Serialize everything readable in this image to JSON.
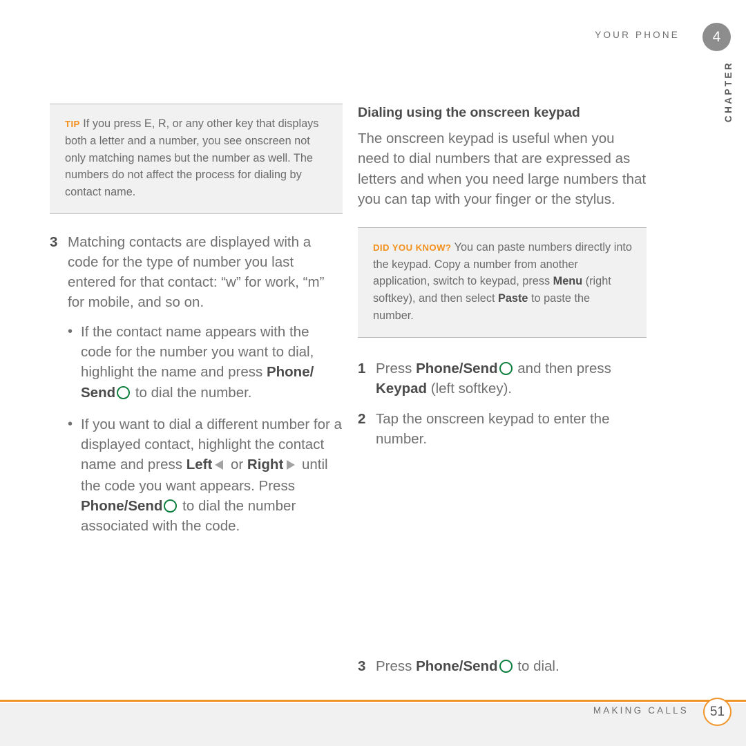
{
  "header": {
    "running_head": "YOUR PHONE",
    "chapter_number": "4",
    "chapter_label": "CHAPTER"
  },
  "colors": {
    "accent_orange": "#f0952a",
    "tag_orange": "#f3901d",
    "send_key_green": "#0f8040",
    "body_gray": "#707070",
    "bold_gray": "#4b4b4b",
    "callout_bg": "#f1f1f1",
    "chapter_badge_gray": "#8d8d8d"
  },
  "left_column": {
    "tip_callout": {
      "tag": "TIP",
      "text": "If you press E, R, or any other key that displays both a letter and a number, you see onscreen not only matching names but the number as well. The numbers do not affect the process for dialing by contact name."
    },
    "step": {
      "number": "3",
      "text": "Matching contacts are displayed with a code for the type of number you last entered for that contact: “w” for work, “m” for mobile, and so on."
    },
    "bullets": [
      {
        "bullet": "•",
        "part1": "If the contact name appears with the code for the number you want to dial, highlight the name and press ",
        "bold1": "Phone/ Send",
        "icon1": "send-key-icon",
        "part2": " to dial the number."
      },
      {
        "bullet": "•",
        "part1": "If you want to dial a different number for a displayed contact, highlight the contact name and press ",
        "bold1": "Left",
        "icon1": "left-arrow-icon",
        "part2": " or ",
        "bold2": "Right",
        "icon2": "right-arrow-icon",
        "part3": " until the code you want appears. Press ",
        "bold3": "Phone/Send",
        "icon3": "send-key-icon",
        "part4": " to dial the number associated with the code."
      }
    ]
  },
  "right_column": {
    "heading": "Dialing using the onscreen keypad",
    "intro": "The onscreen keypad is useful when you need to dial numbers that are expressed as letters and when you need large numbers that you can tap with your finger or the stylus.",
    "did_you_know_callout": {
      "tag": "DID YOU KNOW?",
      "part1": "You can paste numbers directly into the keypad. Copy a number from another application, switch to keypad, press ",
      "bold1": "Menu",
      "part2": " (right softkey), and then select ",
      "bold2": "Paste",
      "part3": " to paste the number."
    },
    "steps": [
      {
        "number": "1",
        "part1": "Press ",
        "bold1": "Phone/Send",
        "icon1": "send-key-icon",
        "part2": " and then press ",
        "bold2": "Keypad",
        "part3": " (left softkey)."
      },
      {
        "number": "2",
        "part1": "Tap the onscreen keypad to enter the number."
      }
    ],
    "final_step": {
      "number": "3",
      "part1": "Press ",
      "bold1": "Phone/Send",
      "icon1": "send-key-icon",
      "part2": " to dial."
    }
  },
  "footer": {
    "title": "MAKING CALLS",
    "page_number": "51"
  }
}
